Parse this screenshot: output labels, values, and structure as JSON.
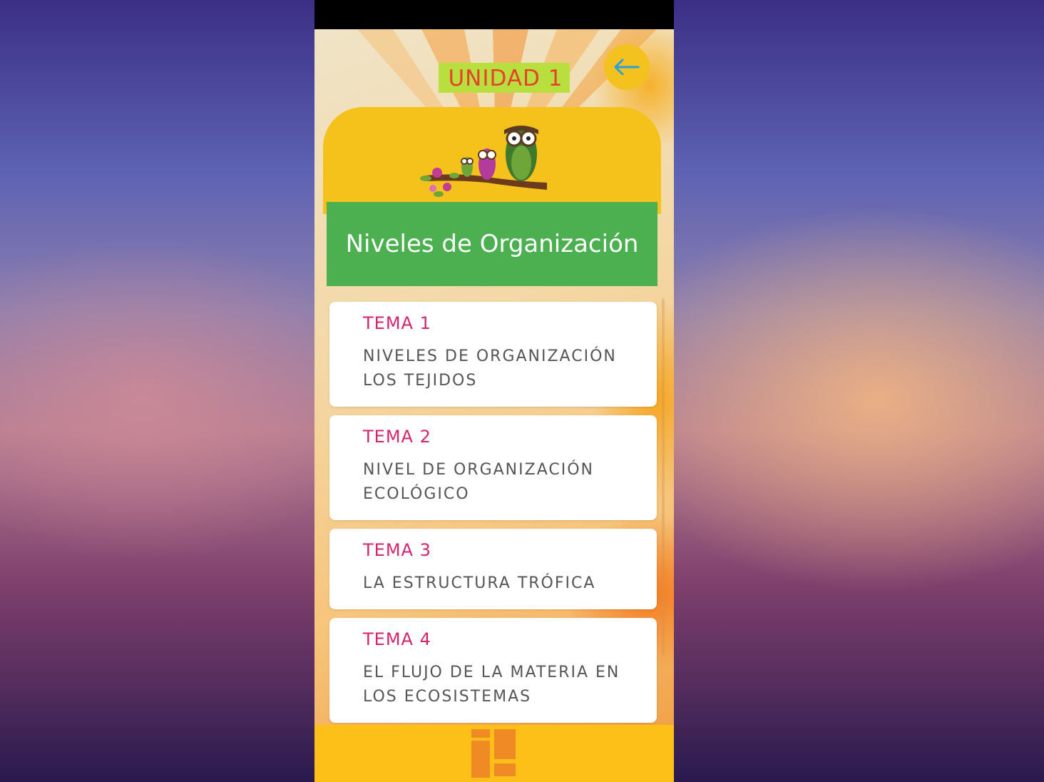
{
  "unit": {
    "title": "UNIDAD 1"
  },
  "topic": {
    "title": "Niveles de Organización"
  },
  "temas": [
    {
      "label": "TEMA 1",
      "description": "NIVELES DE ORGANIZACIÓN\nLOS TEJIDOS"
    },
    {
      "label": "TEMA 2",
      "description": "NIVEL DE ORGANIZACIÓN\nECOLÓGICO"
    },
    {
      "label": "TEMA 3",
      "description": "LA ESTRUCTURA TRÓFICA"
    },
    {
      "label": "TEMA 4",
      "description": "EL FLUJO DE LA MATERIA EN\nLOS ECOSISTEMAS"
    }
  ],
  "icons": {
    "back": "arrow-left-icon",
    "illustration": "owls-on-branch-icon",
    "home": "app-logo-icon"
  },
  "colors": {
    "accent_yellow": "#f5c21c",
    "banner_green": "#4caf50",
    "tema_label": "#d2246f",
    "unit_title_bg": "#b9df3e",
    "unit_title_text": "#e4432a",
    "back_arrow": "#2a9fd8",
    "bottom_bar": "#fdc019"
  }
}
